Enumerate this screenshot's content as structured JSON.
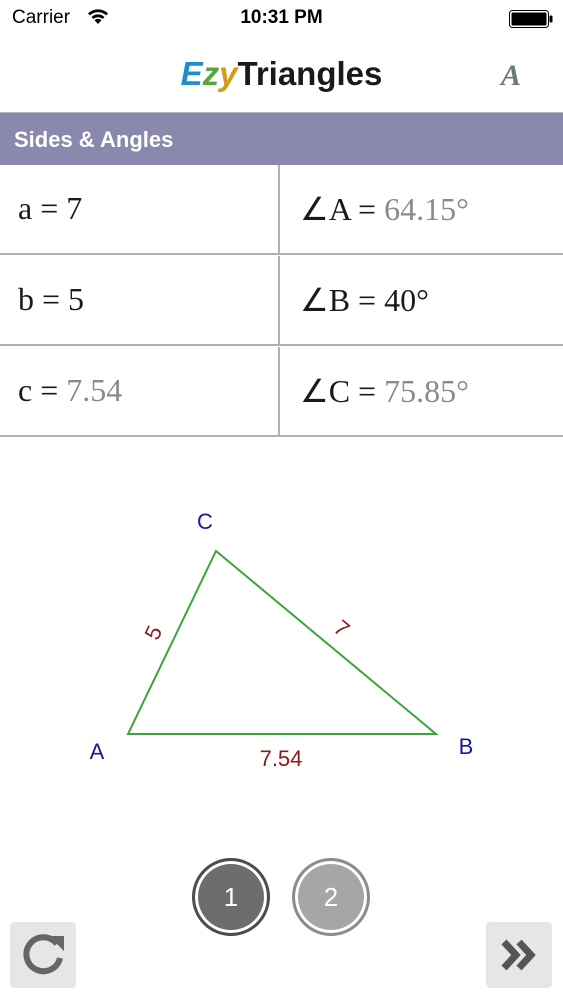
{
  "status_bar": {
    "carrier": "Carrier",
    "time": "10:31 PM",
    "icons": [
      "wifi-icon",
      "battery-icon"
    ]
  },
  "nav": {
    "title_ez_e": "E",
    "title_ez_z": "z",
    "title_ez_y": "y",
    "title_rest": "Triangles",
    "font_button_label": "A"
  },
  "section": {
    "title": "Sides & Angles"
  },
  "values": {
    "side_a": {
      "label": "a = ",
      "value": "7"
    },
    "side_b": {
      "label": "b = ",
      "value": "5"
    },
    "side_c": {
      "label": "c = ",
      "value": "7.54"
    },
    "angle_A": {
      "label": "∠A = ",
      "value": "64.15°"
    },
    "angle_B": {
      "label": "∠B = ",
      "value": "40°"
    },
    "angle_C": {
      "label": "∠C = ",
      "value": "75.85°"
    }
  },
  "diagram": {
    "vertex_A": "A",
    "vertex_B": "B",
    "vertex_C": "C",
    "side_a_label": "7",
    "side_b_label": "5",
    "side_c_label": "7.54",
    "colors": {
      "edge": "#3aa63a",
      "vertex_label": "#1a1a8f",
      "side_label": "#8b1a1a"
    }
  },
  "pager": {
    "page1": "1",
    "page2": "2"
  },
  "toolbar": {
    "reset_icon": "refresh-icon",
    "next_icon": "double-chevron-right-icon"
  }
}
